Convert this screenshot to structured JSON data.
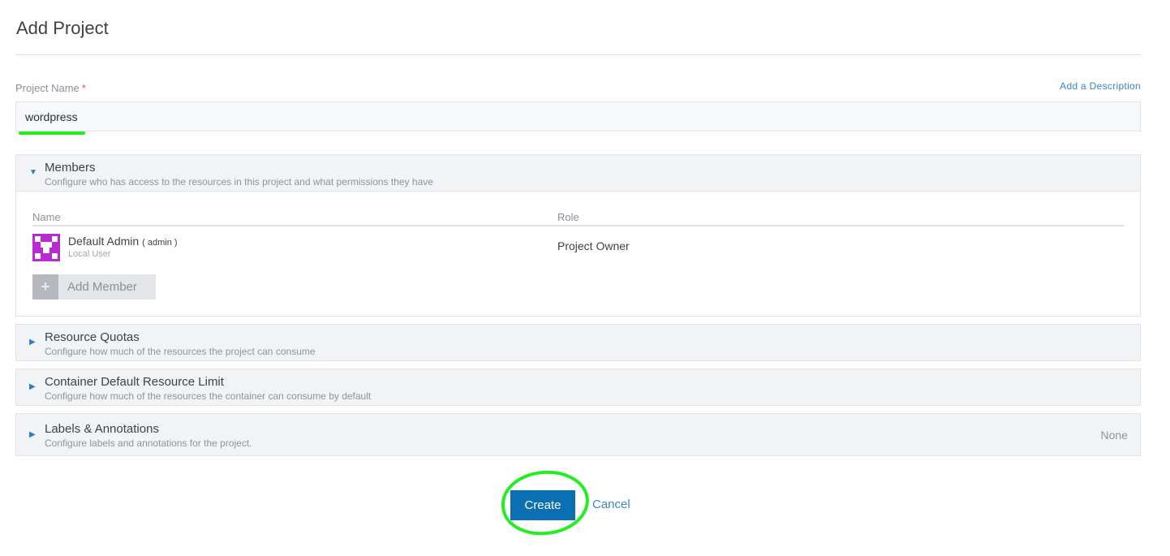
{
  "header": {
    "title": "Add Project"
  },
  "form": {
    "name_label": "Project Name",
    "required_mark": "*",
    "add_description": "Add a Description",
    "name_value": "wordpress"
  },
  "members": {
    "title": "Members",
    "subtitle": "Configure who has access to the resources in this project and what permissions they have",
    "columns": {
      "name": "Name",
      "role": "Role"
    },
    "rows": [
      {
        "name": "Default Admin",
        "username": "( admin )",
        "type": "Local User",
        "role": "Project Owner"
      }
    ],
    "add_button": "Add Member",
    "add_icon": "+"
  },
  "sections": [
    {
      "title": "Resource Quotas",
      "subtitle": "Configure how much of the resources the project can consume",
      "value": ""
    },
    {
      "title": "Container Default Resource Limit",
      "subtitle": "Configure how much of the resources the container can consume by default",
      "value": ""
    },
    {
      "title": "Labels & Annotations",
      "subtitle": "Configure labels and annotations for the project.",
      "value": "None"
    }
  ],
  "icons": {
    "expanded": "▼",
    "collapsed": "▶"
  },
  "actions": {
    "create": "Create",
    "cancel": "Cancel"
  },
  "colors": {
    "accent": "#0a6fb3",
    "link": "#3c86c4",
    "avatar": "#b82bd1",
    "annotation": "#22ee22"
  }
}
